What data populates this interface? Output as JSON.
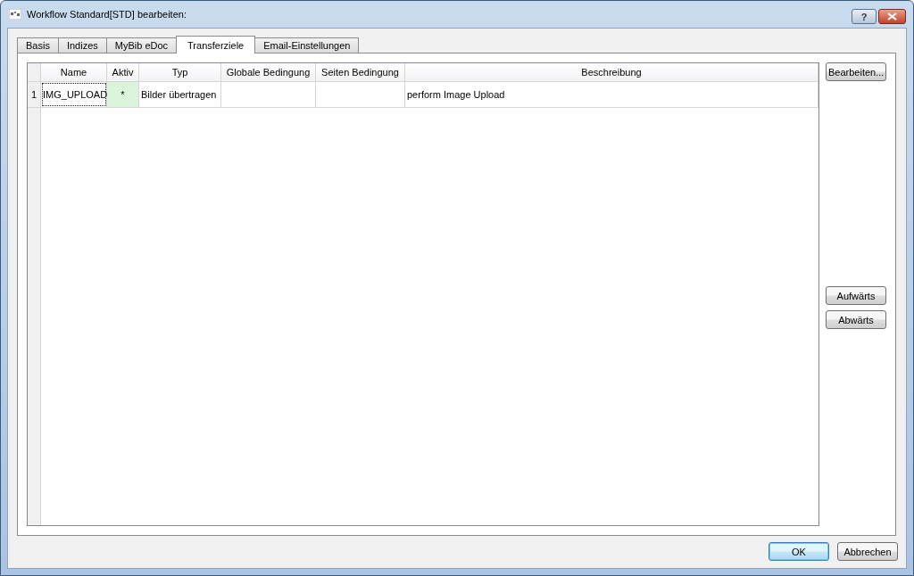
{
  "window": {
    "title": "Workflow Standard[STD] bearbeiten:",
    "help_button": "?"
  },
  "tabs": [
    {
      "label": "Basis",
      "selected": false
    },
    {
      "label": "Indizes",
      "selected": false
    },
    {
      "label": "MyBib eDoc",
      "selected": false
    },
    {
      "label": "Transferziele",
      "selected": true
    },
    {
      "label": "Email-Einstellungen",
      "selected": false
    }
  ],
  "table": {
    "columns": [
      "Name",
      "Aktiv",
      "Typ",
      "Globale Bedingung",
      "Seiten Bedingung",
      "Beschreibung"
    ],
    "rows": [
      {
        "number": "1",
        "cells": [
          {
            "text": "IMG_UPLOAD",
            "focused": true,
            "highlighted": false
          },
          {
            "text": "*",
            "focused": false,
            "highlighted": true
          },
          {
            "text": "Bilder übertragen",
            "focused": false,
            "highlighted": false
          },
          {
            "focused": false,
            "highlighted": false
          },
          {
            "focused": false,
            "highlighted": false
          },
          {
            "text": "perform Image Upload",
            "focused": false,
            "highlighted": false
          }
        ]
      }
    ]
  },
  "side_buttons": {
    "top": [
      "Bearbeiten..."
    ],
    "middle": [
      "Aufwärts",
      "Abwärts"
    ]
  },
  "buttons": [
    {
      "label": "OK",
      "default": true
    },
    {
      "label": "Abbrechen",
      "default": false
    }
  ]
}
